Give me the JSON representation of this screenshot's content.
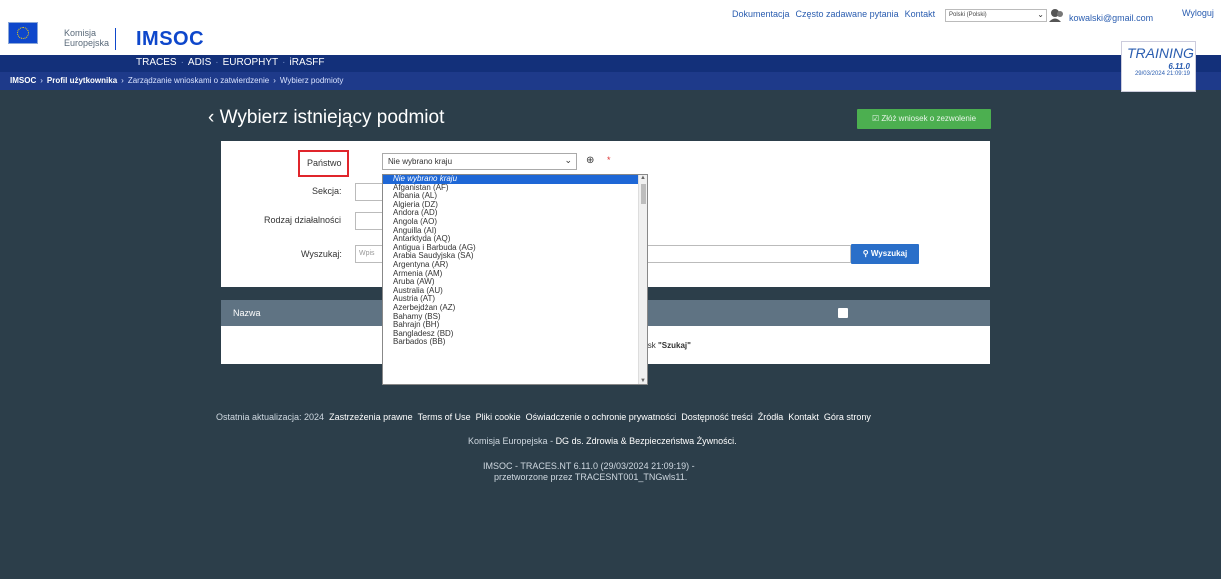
{
  "header": {
    "ec_name_line1": "Komisja",
    "ec_name_line2": "Europejska",
    "app_title": "IMSOC",
    "links": [
      "Dokumentacja",
      "Często zadawane pytania",
      "Kontakt"
    ],
    "language": "Polski (Polski)",
    "user_email": "kowalski@gmail.com",
    "logout": "Wyloguj"
  },
  "modules": [
    "TRACES",
    "ADIS",
    "EUROPHYT",
    "iRASFF"
  ],
  "breadcrumb": {
    "root": "IMSOC",
    "items": [
      "Profil użytkownika",
      "Zarządzanie wnioskami o zatwierdzenie",
      "Wybierz podmioty"
    ]
  },
  "training": {
    "label": "TRAINING",
    "version": "6.11.0",
    "datetime": "29/03/2024 21:09:19"
  },
  "page": {
    "title": "Wybierz istniejący podmiot",
    "apply_button": "Złóż wniosek o zezwolenie"
  },
  "filters": {
    "country_label": "Państwo",
    "country_value": "Nie wybrano kraju",
    "section_label": "Sekcja:",
    "activity_label": "Rodzaj działalności",
    "search_label": "Wyszukaj:",
    "search_placeholder": "Wpis",
    "search_button": "Wyszukaj"
  },
  "table": {
    "col_name": "Nazwa",
    "empty_message_prefix": "ycisk ",
    "empty_message_bold": "\"Szukaj\""
  },
  "dropdown": {
    "options": [
      "Nie wybrano kraju",
      "Afganistan (AF)",
      "Albania (AL)",
      "Algieria (DZ)",
      "Andora (AD)",
      "Angola (AO)",
      "Anguilla (AI)",
      "Antarktyda (AQ)",
      "Antigua i Barbuda (AG)",
      "Arabia Saudyjska (SA)",
      "Argentyna (AR)",
      "Armenia (AM)",
      "Aruba (AW)",
      "Australia (AU)",
      "Austria (AT)",
      "Azerbejdżan (AZ)",
      "Bahamy (BS)",
      "Bahrajn (BH)",
      "Bangladesz (BD)",
      "Barbados (BB)"
    ],
    "selected_index": 0
  },
  "footer": {
    "last_update": "Ostatnia aktualizacja: 2024",
    "links": [
      "Zastrzeżenia prawne",
      "Terms of Use",
      "Pliki cookie",
      "Oświadczenie o ochronie prywatności",
      "Dostępność treści",
      "Źródła",
      "Kontakt",
      "Góra strony"
    ],
    "org": "Komisja Europejska",
    "dg": "DG ds. Zdrowia & Bezpieczeństwa Żywności.",
    "version_line": "IMSOC - TRACES.NT 6.11.0 (29/03/2024 21:09:19) -",
    "processed_line": "przetworzone przez TRACESNT001_TNGwls11."
  },
  "colors": {
    "brand_blue": "#0e47cb",
    "module_bar": "#13307a",
    "page_bg": "#2c3e4a",
    "accent_green": "#4caf50",
    "search_blue": "#2a6fc9",
    "highlight_red": "#e0252b"
  }
}
